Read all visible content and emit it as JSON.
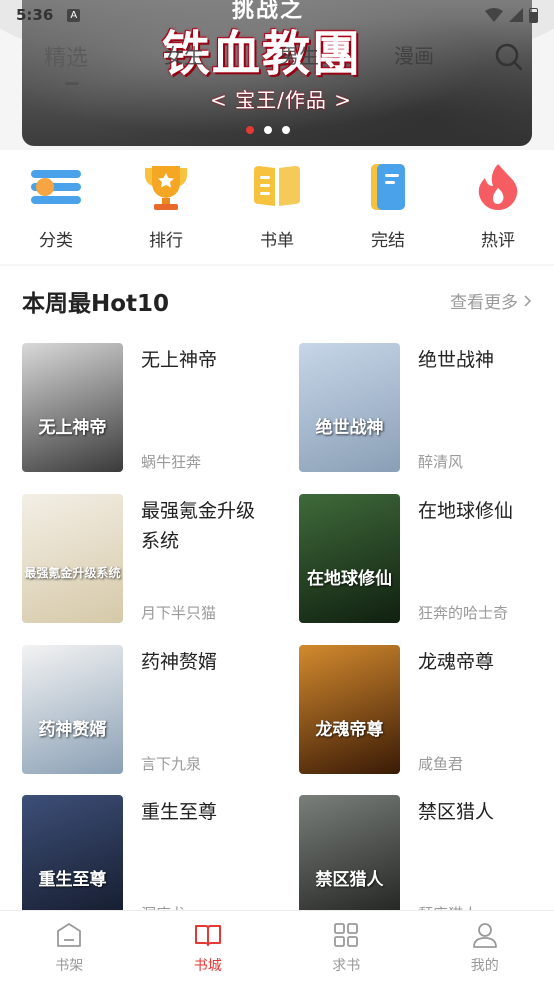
{
  "status_bar": {
    "time": "5:36",
    "badge": "A"
  },
  "top_tabs": [
    "精选",
    "女生",
    "男生",
    "漫画"
  ],
  "banner": {
    "top_text": "挑战之",
    "title": "铁血教團",
    "subtitle": "< 宝王/作品 >",
    "dots": 3,
    "active_dot": 0
  },
  "categories": [
    {
      "label": "分类",
      "icon": "category-icon"
    },
    {
      "label": "排行",
      "icon": "trophy-icon"
    },
    {
      "label": "书单",
      "icon": "book-list-icon"
    },
    {
      "label": "完结",
      "icon": "finished-book-icon"
    },
    {
      "label": "热评",
      "icon": "flame-icon"
    }
  ],
  "section": {
    "title": "本周最Hot10",
    "more": "查看更多"
  },
  "books": [
    {
      "title": "无上神帝",
      "author": "蜗牛狂奔",
      "cover_text": "无上神帝",
      "cover_colors": [
        "#d9d9d9",
        "#3a3a3a"
      ]
    },
    {
      "title": "绝世战神",
      "author": "醉清风",
      "cover_text": "绝世战神",
      "cover_colors": [
        "#c7d6e8",
        "#8a9fb6"
      ]
    },
    {
      "title": "最强氪金升级系统",
      "author": "月下半只猫",
      "cover_text": "最强氪金升级系统",
      "cover_colors": [
        "#f3efe6",
        "#d6c9a8"
      ]
    },
    {
      "title": "在地球修仙",
      "author": "狂奔的哈士奇",
      "cover_text": "在地球修仙",
      "cover_colors": [
        "#3f6a3a",
        "#102010"
      ]
    },
    {
      "title": "药神赘婿",
      "author": "言下九泉",
      "cover_text": "药神赘婿",
      "cover_colors": [
        "#f3f3f3",
        "#8aa0b5"
      ]
    },
    {
      "title": "龙魂帝尊",
      "author": "咸鱼君",
      "cover_text": "龙魂帝尊",
      "cover_colors": [
        "#d38a2e",
        "#3a1a06"
      ]
    },
    {
      "title": "重生至尊",
      "author": "洞庭龙",
      "cover_text": "重生至尊",
      "cover_colors": [
        "#3d4f78",
        "#141a2b"
      ]
    },
    {
      "title": "禁区猎人",
      "author": "颓废猫人",
      "cover_text": "禁区猎人",
      "cover_colors": [
        "#7a7f7a",
        "#1e201e"
      ]
    }
  ],
  "bottom_nav": [
    {
      "label": "书架",
      "icon": "bookshelf-icon",
      "active": false
    },
    {
      "label": "书城",
      "icon": "bookstore-icon",
      "active": true
    },
    {
      "label": "求书",
      "icon": "request-icon",
      "active": false
    },
    {
      "label": "我的",
      "icon": "profile-icon",
      "active": false
    }
  ],
  "colors": {
    "accent": "#e53935",
    "muted": "#9a9a9a"
  }
}
